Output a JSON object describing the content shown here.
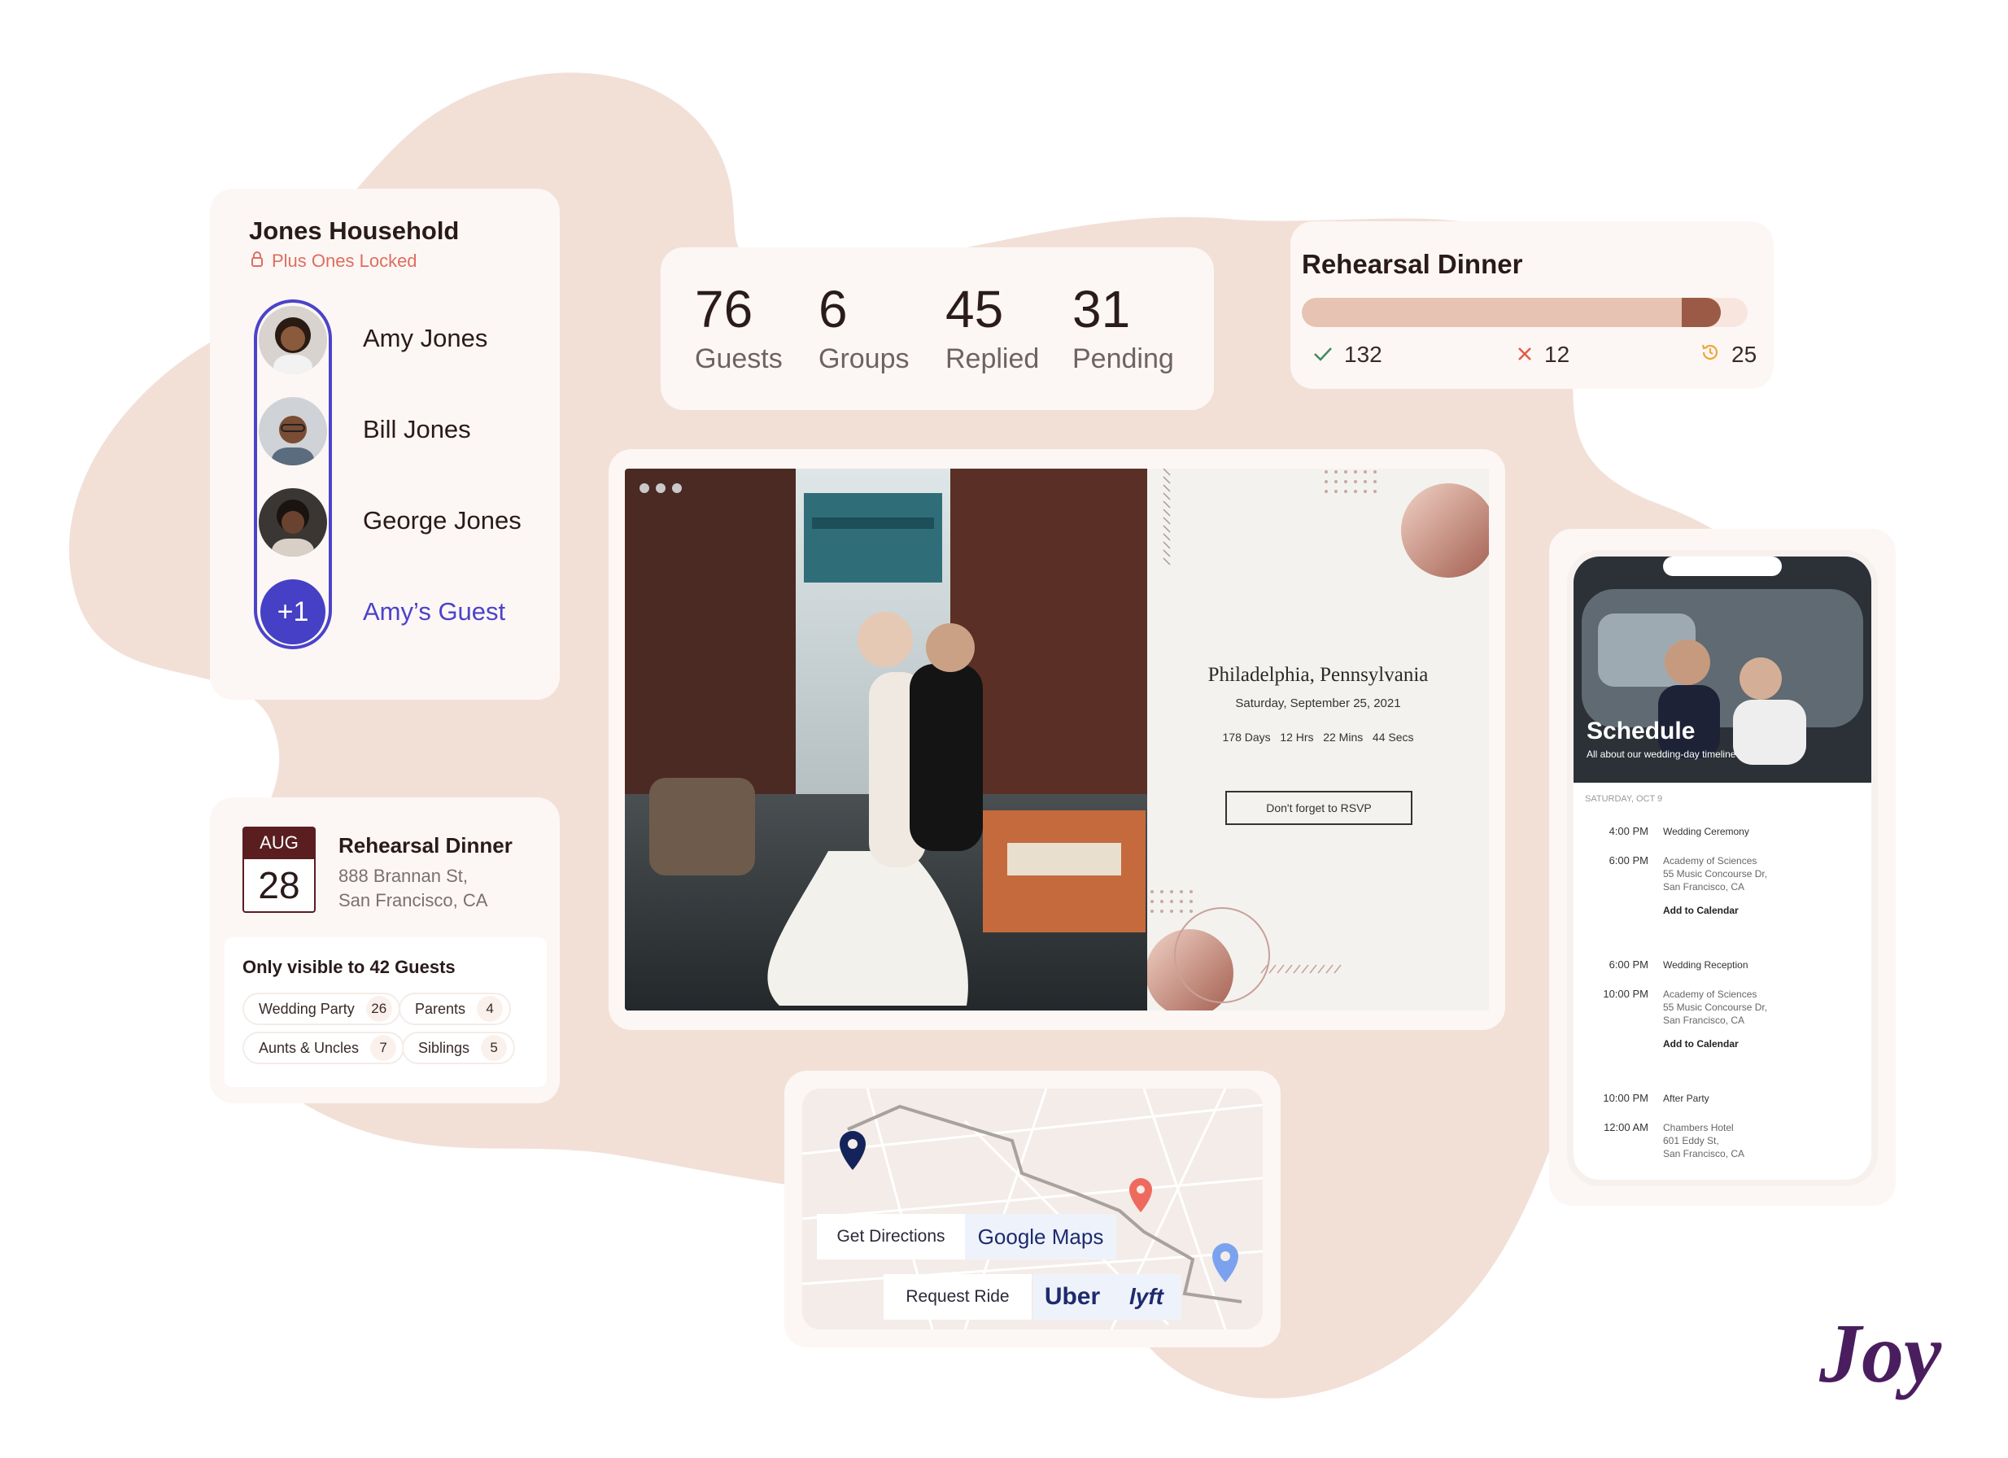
{
  "household": {
    "title": "Jones Household",
    "lock_text": "Plus Ones Locked",
    "members": [
      "Amy Jones",
      "Bill Jones",
      "George Jones"
    ],
    "plus_one_badge": "+1",
    "guest_label": "Amy’s Guest"
  },
  "stats": [
    {
      "value": "76",
      "label": "Guests"
    },
    {
      "value": "6",
      "label": "Groups"
    },
    {
      "value": "45",
      "label": "Replied"
    },
    {
      "value": "31",
      "label": "Pending"
    }
  ],
  "rehearsal": {
    "title": "Rehearsal Dinner",
    "accepted": "132",
    "declined": "12",
    "pending": "25",
    "progress_fraction": 0.94
  },
  "event": {
    "month": "AUG",
    "day": "28",
    "title": "Rehearsal Dinner",
    "address_line1": "888 Brannan St,",
    "address_line2": "San Francisco, CA",
    "visibility": "Only visible to 42 Guests",
    "groups": [
      {
        "name": "Wedding Party",
        "count": "26"
      },
      {
        "name": "Parents",
        "count": "4"
      },
      {
        "name": "Aunts & Uncles",
        "count": "7"
      },
      {
        "name": "Siblings",
        "count": "5"
      }
    ]
  },
  "website": {
    "city": "Philadelphia, Pennsylvania",
    "date": "Saturday, September 25, 2021",
    "countdown": "178 Days   12 Hrs   22 Mins   44 Secs",
    "rsvp_button": "Don't forget to RSVP"
  },
  "schedule": {
    "title": "Schedule",
    "subtitle": "All about our wedding-day timeline",
    "day": "SATURDAY, OCT 9",
    "add_label": "Add to Calendar",
    "items": [
      {
        "start": "4:00 PM",
        "end": "6:00 PM",
        "name": "Wedding Ceremony",
        "venue": "Academy of Sciences",
        "addr1": "55 Music Concourse Dr,",
        "addr2": "San Francisco, CA"
      },
      {
        "start": "6:00 PM",
        "end": "10:00 PM",
        "name": "Wedding Reception",
        "venue": "Academy of Sciences",
        "addr1": "55 Music Concourse Dr,",
        "addr2": "San Francisco, CA"
      },
      {
        "start": "10:00 PM",
        "end": "12:00 AM",
        "name": "After Party",
        "venue": "Chambers Hotel",
        "addr1": "601 Eddy St,",
        "addr2": "San Francisco, CA"
      }
    ]
  },
  "map": {
    "directions_label": "Get Directions",
    "google_maps": "Google Maps",
    "ride_label": "Request Ride",
    "uber": "Uber",
    "lyft": "lyft"
  },
  "brand": {
    "logo": "Joy",
    "accent": "#4540c6",
    "brand_purple": "#4a1e5e",
    "lock_red": "#e06c5e"
  }
}
